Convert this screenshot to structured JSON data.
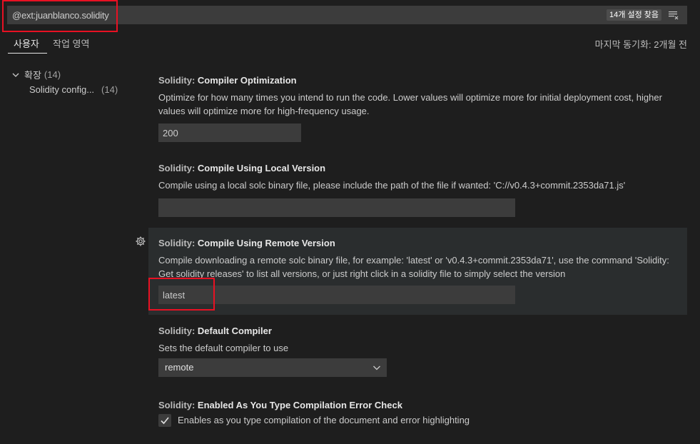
{
  "search": {
    "value": "@ext:juanblanco.solidity",
    "result_count": "14개 설정 찾음",
    "clear_filter_icon": "clear-filter-icon"
  },
  "tabs": [
    {
      "label": "사용자",
      "active": true
    },
    {
      "label": "작업 영역",
      "active": false
    }
  ],
  "sync_status": "마지막 동기화: 2개월 전",
  "toc": {
    "group": {
      "label": "확장",
      "count": "(14)"
    },
    "items": [
      {
        "label": "Solidity config...",
        "count": "(14)"
      }
    ]
  },
  "settings": [
    {
      "category": "Solidity:",
      "name": "Compiler Optimization",
      "description": "Optimize for how many times you intend to run the code. Lower values will optimize more for initial deployment cost, higher values will optimize more for high-frequency usage.",
      "value": "200"
    },
    {
      "category": "Solidity:",
      "name": "Compile Using Local Version",
      "description": "Compile using a local solc binary file, please include the path of the file if wanted: 'C://v0.4.3+commit.2353da71.js'",
      "value": ""
    },
    {
      "category": "Solidity:",
      "name": "Compile Using Remote Version",
      "description": "Compile downloading a remote solc binary file, for example: 'latest' or 'v0.4.3+commit.2353da71', use the command 'Solidity: Get solidity releases' to list all versions, or just right click in a solidity file to simply select the version",
      "value": "latest"
    },
    {
      "category": "Solidity:",
      "name": "Default Compiler",
      "description": "Sets the default compiler to use",
      "value": "remote"
    },
    {
      "category": "Solidity:",
      "name": "Enabled As You Type Compilation Error Check",
      "description": "Enables as you type compilation of the document and error highlighting",
      "checked": true
    }
  ],
  "colors": {
    "background": "#1e1e1e",
    "input_background": "#3c3c3c",
    "highlight_box": "#e81123",
    "focused_row": "#2a2d2e"
  }
}
